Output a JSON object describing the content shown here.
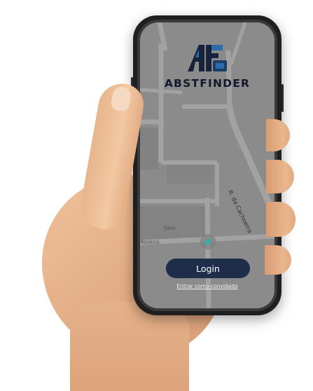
{
  "app": {
    "brand_name": "ABSTFINDER",
    "logo_letters": "AF"
  },
  "map": {
    "street_labels": [
      "R. da Cachoeira"
    ],
    "poi_labels": [
      "Sesi",
      "Moreno"
    ]
  },
  "actions": {
    "login_label": "Login",
    "guest_link_label": "Entrar como convidado"
  },
  "colors": {
    "screen_overlay": "#8d8d8d",
    "map_roads": "#a2a2a2",
    "brand_navy": "#1e2e4a",
    "logo_blue": "#2a6ca8",
    "marker_teal": "#2ab3a6",
    "skin": "#e9b791"
  }
}
